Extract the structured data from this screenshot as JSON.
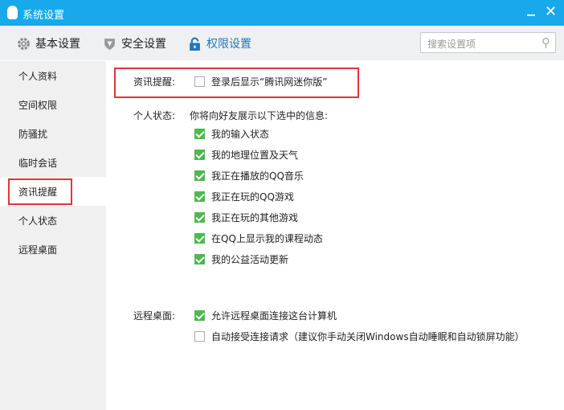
{
  "window": {
    "title": "系统设置"
  },
  "toolbar": {
    "tabs": [
      {
        "label": "基本设置"
      },
      {
        "label": "安全设置"
      },
      {
        "label": "权限设置"
      }
    ],
    "search_placeholder": "搜索设置项"
  },
  "sidebar": {
    "items": [
      {
        "label": "个人资料"
      },
      {
        "label": "空间权限"
      },
      {
        "label": "防骚扰"
      },
      {
        "label": "临时会话"
      },
      {
        "label": "资讯提醒"
      },
      {
        "label": "个人状态"
      },
      {
        "label": "远程桌面"
      }
    ],
    "selected": "资讯提醒"
  },
  "news": {
    "label": "资讯提醒:",
    "option": "登录后显示“腾讯网迷你版”",
    "checked": false
  },
  "status": {
    "label": "个人状态:",
    "desc": "你将向好友展示以下选中的信息:",
    "options": [
      {
        "label": "我的输入状态",
        "checked": true
      },
      {
        "label": "我的地理位置及天气",
        "checked": true
      },
      {
        "label": "我正在播放的QQ音乐",
        "checked": true
      },
      {
        "label": "我正在玩的QQ游戏",
        "checked": true
      },
      {
        "label": "我正在玩的其他游戏",
        "checked": true
      },
      {
        "label": "在QQ上显示我的课程动态",
        "checked": true
      },
      {
        "label": "我的公益活动更新",
        "checked": true
      }
    ]
  },
  "remote": {
    "label": "远程桌面:",
    "options": [
      {
        "label": "允许远程桌面连接这台计算机",
        "checked": true
      },
      {
        "label": "自动接受连接请求（建议你手动关闭Windows自动睡眠和自动锁屏功能）",
        "checked": false
      }
    ]
  },
  "colors": {
    "titlebar": "#17a9ec",
    "highlight": "#e53338",
    "check": "#4fb84f",
    "active_tab": "#2277bb"
  }
}
